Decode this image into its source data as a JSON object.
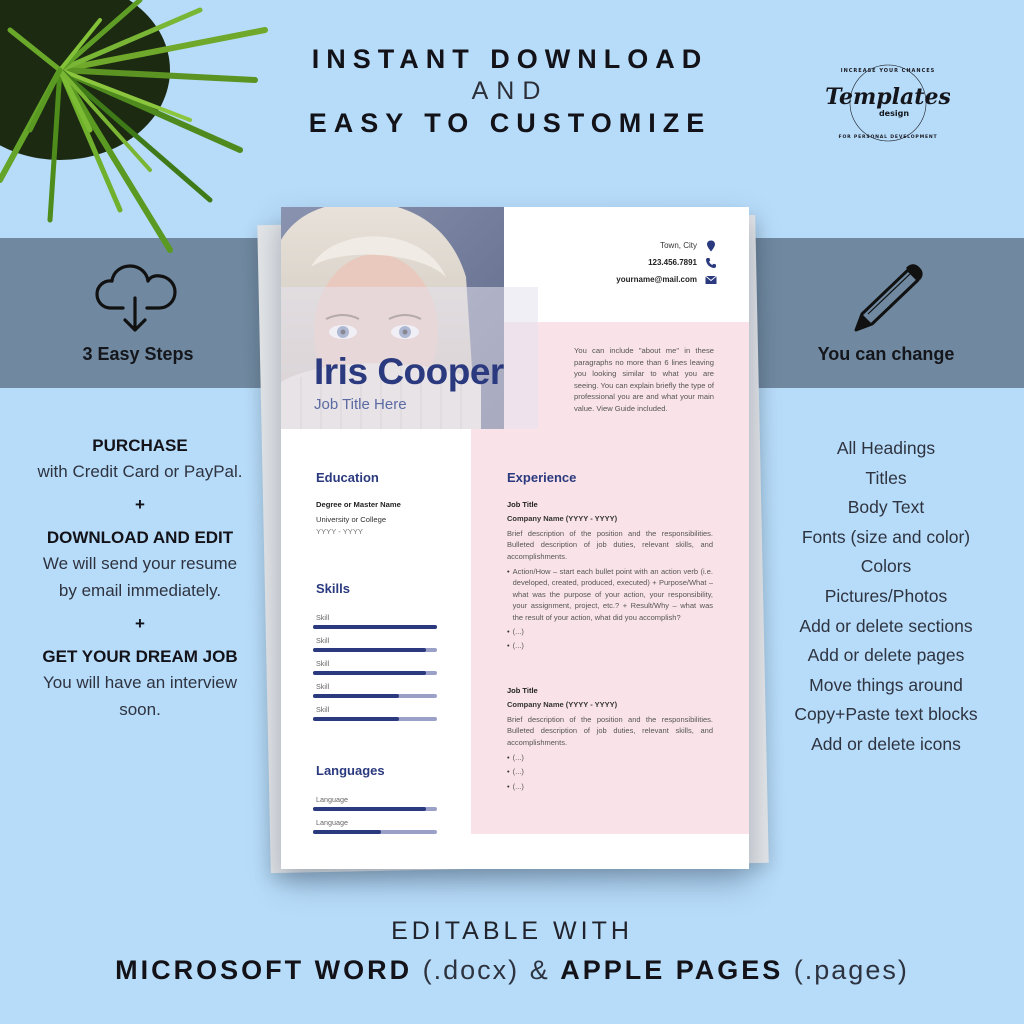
{
  "headline": {
    "line1": "INSTANT DOWNLOAD",
    "line2": "AND",
    "line3": "EASY TO CUSTOMIZE"
  },
  "logo": {
    "brand": "Templates",
    "sub": "design",
    "ring_text_top": "INCREASE YOUR CHANCES",
    "ring_text_bottom": "FOR PERSONAL DEVELOPMENT"
  },
  "left": {
    "icon": "cloud-download-icon",
    "title": "3 Easy Steps",
    "steps": [
      {
        "heading": "PURCHASE",
        "text": [
          "with Credit Card or PayPal."
        ]
      },
      {
        "heading": "DOWNLOAD AND EDIT",
        "text": [
          "We will send your resume",
          "by email immediately."
        ]
      },
      {
        "heading": "GET YOUR DREAM JOB",
        "text": [
          "You will have an interview",
          "soon."
        ]
      }
    ],
    "separator": "+"
  },
  "right": {
    "icon": "pencil-icon",
    "title": "You can change",
    "items": [
      "All Headings",
      "Titles",
      "Body Text",
      "Fonts (size and color)",
      "Colors",
      "Pictures/Photos",
      "Add or delete sections",
      "Add or delete pages",
      "Move things around",
      "Copy+Paste text blocks",
      "Add or delete icons"
    ]
  },
  "resume": {
    "name": "Iris Cooper",
    "job_title": "Job Title Here",
    "contact": {
      "location": "Town, City",
      "phone": "123.456.7891",
      "email": "yourname@mail.com"
    },
    "about": "You can include \"about me\" in these paragraphs no more than 6 lines leaving you looking similar to what you are seeing. You can explain briefly the type of professional you are and what your main value. View Guide included.",
    "education": {
      "heading": "Education",
      "degree": "Degree or Master Name",
      "school": "University or College",
      "years": "YYYY - YYYY"
    },
    "skills": {
      "heading": "Skills",
      "items": [
        {
          "label": "Skill",
          "level": 1.0
        },
        {
          "label": "Skill",
          "level": 0.91
        },
        {
          "label": "Skill",
          "level": 0.91
        },
        {
          "label": "Skill",
          "level": 0.69
        },
        {
          "label": "Skill",
          "level": 0.69
        }
      ]
    },
    "languages": {
      "heading": "Languages",
      "items": [
        {
          "label": "Language",
          "level": 0.91
        },
        {
          "label": "Language",
          "level": 0.55
        }
      ]
    },
    "experience": {
      "heading": "Experience",
      "jobs": [
        {
          "title": "Job Title",
          "company": "Company Name (YYYY - YYYY)",
          "description": "Brief description of the position and the responsibilities. Bulleted description of job duties, relevant skills, and accomplishments.",
          "bullets": [
            "Action/How – start each bullet point with an action verb (i.e. developed, created, produced, executed) + Purpose/What – what was the purpose of your action, your responsibility, your assignment, project, etc.? + Result/Why – what was the result of your action, what did you accomplish?",
            "(...)",
            "(...)"
          ]
        },
        {
          "title": "Job Title",
          "company": "Company Name (YYYY - YYYY)",
          "description": "Brief description of the position and the responsibilities. Bulleted description of job duties, relevant skills, and accomplishments.",
          "bullets": [
            "(...)",
            "(...)",
            "(...)"
          ]
        }
      ]
    }
  },
  "footer": {
    "line1": "EDITABLE WITH",
    "word_bold": "MICROSOFT WORD",
    "word_ext": "(.docx)",
    "amp": "&",
    "pages_bold": "APPLE PAGES",
    "pages_ext": "(.pages)"
  },
  "colors": {
    "background": "#b7dcf9",
    "band": "#7089a0",
    "accent": "#2b3a7e",
    "pink_panel": "#f9e3e8"
  }
}
